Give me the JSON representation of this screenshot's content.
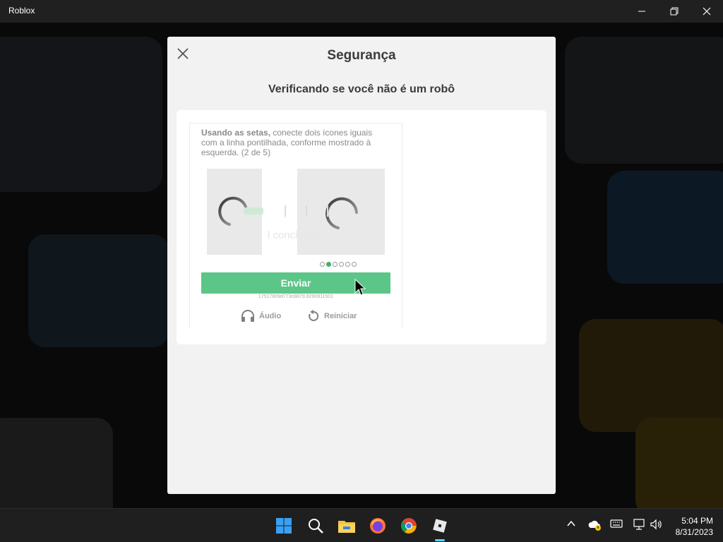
{
  "window": {
    "title": "Roblox"
  },
  "modal": {
    "header": "Segurança",
    "subtitle": "Verificando se você não é um robô"
  },
  "captcha": {
    "instruction_bold": "Usando as setas,",
    "instruction_rest": " conecte dois ícones iguais com a linha pontilhada, conforme mostrado à esquerda. (2 de 5)",
    "ghost_text": "l concluído",
    "progress": {
      "total": 6,
      "active_index": 1
    },
    "submit_label": "Enviar",
    "token": "17517809d773c8879.9290911501",
    "audio_label": "Áudio",
    "restart_label": "Reiniciar"
  },
  "taskbar": {
    "icons": [
      "windows-start-icon",
      "search-icon",
      "file-explorer-icon",
      "firefox-icon",
      "chrome-icon",
      "roblox-icon"
    ],
    "clock_time": "5:04 PM",
    "clock_date": "8/31/2023"
  },
  "colors": {
    "accent_green": "#5cc688",
    "active_dot": "#43b26a",
    "taskbar_indicator": "#60cdff"
  }
}
